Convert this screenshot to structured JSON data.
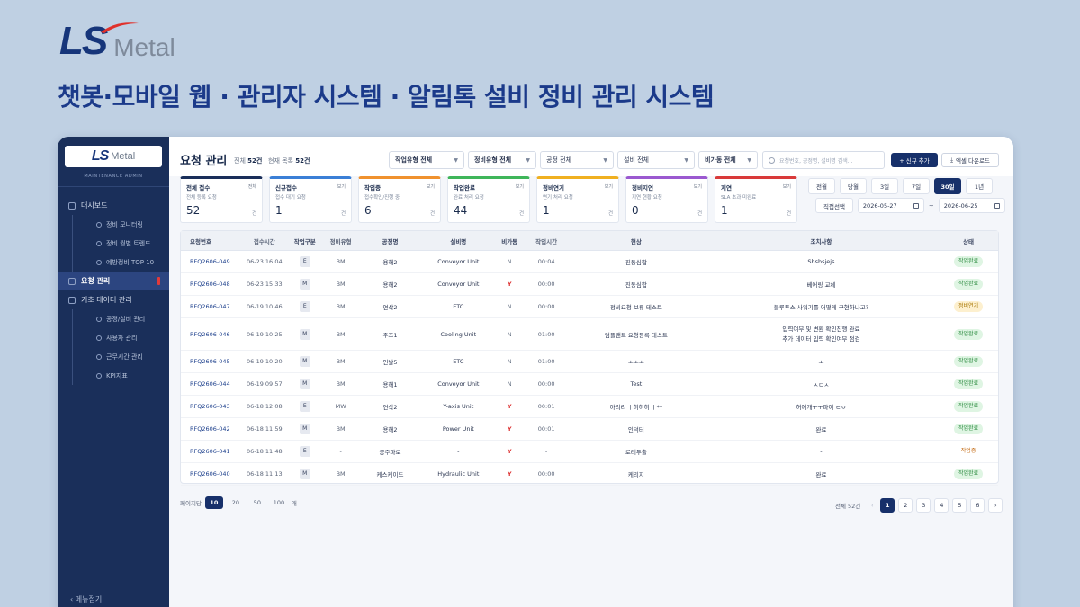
{
  "brand": {
    "ls": "LS",
    "metal": "Metal"
  },
  "headline": "챗봇·모바일 웹 · 관리자 시스템 · 알림톡 설비 정비 관리 시스템",
  "sidebar": {
    "logo_ls": "LS",
    "logo_metal": "Metal",
    "subtitle": "MAINTENANCE ADMIN",
    "dashboard": "대시보드",
    "dashboard_items": [
      "정비 모니터링",
      "정비 월별 트렌드",
      "예방정비 TOP 10"
    ],
    "requests": "요청 관리",
    "master": "기초 데이터 관리",
    "master_items": [
      "공정/설비 관리",
      "사용자 관리",
      "근무시간 관리",
      "KPI지표"
    ],
    "collapse": "‹ 메뉴접기"
  },
  "header": {
    "title": "요청 관리",
    "meta_total_label": "전체",
    "meta_total": "52건",
    "meta_sep": "·",
    "meta_list_label": "현재 목록",
    "meta_list": "52건"
  },
  "filters": [
    "작업유형 전체",
    "정비유형 전체",
    "공정 전체",
    "설비 전체",
    "비가동 전체"
  ],
  "search_placeholder": "요청번호, 공정명, 설비명 검색...",
  "buttons": {
    "new": "+ 신규 추가",
    "excel": "엑셀 다운로드"
  },
  "cards": [
    {
      "title": "전체 접수",
      "sub": "전체 등록 요청",
      "value": "52",
      "unit": "건",
      "tag": "전체",
      "color": "#1a2f5a"
    },
    {
      "title": "신규접수",
      "sub": "접수 대기 요청",
      "value": "1",
      "unit": "건",
      "tag": "보기",
      "color": "#3b7fd6"
    },
    {
      "title": "작업중",
      "sub": "접수확인/진행 중",
      "value": "6",
      "unit": "건",
      "tag": "보기",
      "color": "#f0922e"
    },
    {
      "title": "작업완료",
      "sub": "완료 처리 요청",
      "value": "44",
      "unit": "건",
      "tag": "보기",
      "color": "#3fb65a"
    },
    {
      "title": "정비연기",
      "sub": "연기 처리 요청",
      "value": "1",
      "unit": "건",
      "tag": "보기",
      "color": "#f0b020"
    },
    {
      "title": "정비지연",
      "sub": "지연 현황 요청",
      "value": "0",
      "unit": "건",
      "tag": "보기",
      "color": "#9b59d0"
    },
    {
      "title": "지연",
      "sub": "SLA 초과 미완료",
      "value": "1",
      "unit": "건",
      "tag": "보기",
      "color": "#d93a3a"
    }
  ],
  "periods": [
    "전월",
    "당월",
    "3일",
    "7일",
    "30일",
    "1년"
  ],
  "date": {
    "direct": "직접선택",
    "from": "2026-05-27",
    "sep": "~",
    "to": "2026-06-25"
  },
  "table": {
    "headers": [
      "요청번호",
      "접수시간",
      "작업구분",
      "정비유형",
      "공정명",
      "설비명",
      "비가동",
      "작업시간",
      "현상",
      "조치사항",
      "상태"
    ],
    "rows": [
      [
        "RFQ2606-049",
        "06-23 16:04",
        "E",
        "BM",
        "용해2",
        "Conveyor Unit",
        "N",
        "00:04",
        "진동심함",
        "Shshsjejs",
        "작업완료"
      ],
      [
        "RFQ2606-048",
        "06-23 15:33",
        "M",
        "BM",
        "용해2",
        "Conveyor Unit",
        "Y",
        "00:00",
        "진동심함",
        "베어링 교체",
        "작업완료"
      ],
      [
        "RFQ2606-047",
        "06-19 10:46",
        "E",
        "BM",
        "연삭2",
        "ETC",
        "N",
        "00:00",
        "정비요청 보류 테스트",
        "블루투스 사워기를 어떻게 구현하나고?",
        "정비연기"
      ],
      [
        "RFQ2606-046",
        "06-19 10:25",
        "M",
        "BM",
        "주조1",
        "Cooling Unit",
        "N",
        "01:00",
        "럼플랜트 요청등록 테스트",
        "입력여부 및 변환 확인진행 완료\n추가 데이터 입력 확인여부 점검",
        "작업완료"
      ],
      [
        "RFQ2606-045",
        "06-19 10:20",
        "M",
        "BM",
        "인발5",
        "ETC",
        "N",
        "01:00",
        "ㅗㅗㅗ",
        "ㅗ",
        "작업완료"
      ],
      [
        "RFQ2606-044",
        "06-19 09:57",
        "M",
        "BM",
        "용해1",
        "Conveyor Unit",
        "N",
        "00:00",
        "Test",
        "ㅅㄷㅅ",
        "작업완료"
      ],
      [
        "RFQ2606-043",
        "06-18 12:08",
        "E",
        "MW",
        "연삭2",
        "Y-axis Unit",
        "Y",
        "00:01",
        "아리리 ㅣ히히히 ㅣ**",
        "허에개ㅜㅜ파이 ㅌㅇ",
        "작업완료"
      ],
      [
        "RFQ2606-042",
        "06-18 11:59",
        "M",
        "BM",
        "용해2",
        "Power Unit",
        "Y",
        "00:01",
        "인덕터",
        "완료",
        "작업완료"
      ],
      [
        "RFQ2606-041",
        "06-18 11:48",
        "E",
        "-",
        "공주파로",
        "-",
        "Y",
        "-",
        "로테두출",
        "-",
        "작업중"
      ],
      [
        "RFQ2606-040",
        "06-18 11:13",
        "M",
        "BM",
        "케스케이드",
        "Hydraulic Unit",
        "Y",
        "00:00",
        "케리지",
        "완료",
        "작업완료"
      ]
    ]
  },
  "pagination": {
    "size_label": "페이지당",
    "sizes": [
      "10",
      "20",
      "50",
      "100"
    ],
    "size_unit": "개",
    "total": "전체 52건",
    "prev": "‹",
    "pages": [
      "1",
      "2",
      "3",
      "4",
      "5",
      "6"
    ],
    "next": "›"
  }
}
